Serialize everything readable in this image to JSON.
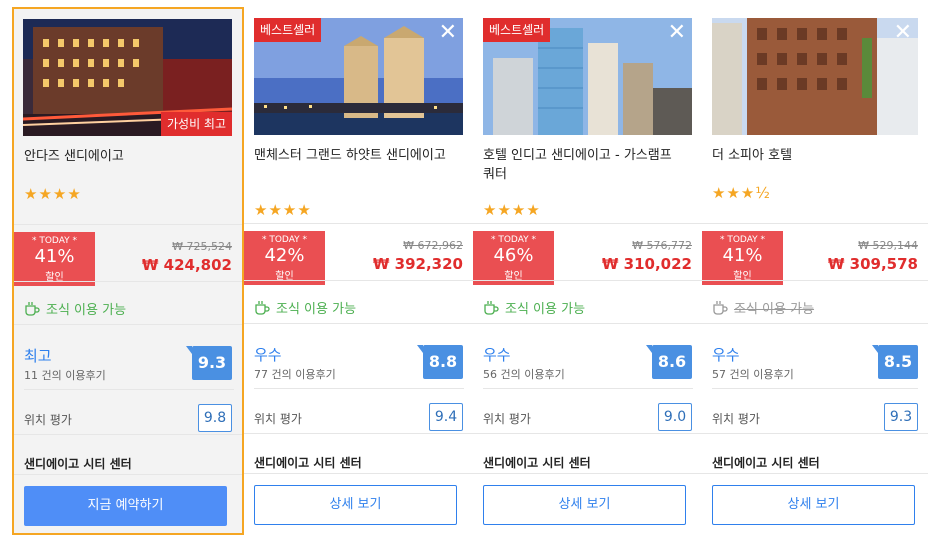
{
  "cards": [
    {
      "name": "안다즈 샌디에이고",
      "badge_bottom": "가성비 최고",
      "stars": "★★★★",
      "today_label": "* TODAY *",
      "discount": "41%",
      "discount_sub": "할인",
      "old_price": "₩ 725,524",
      "new_price": "₩ 424,802",
      "breakfast": "조식 이용 가능",
      "rating_word": "최고",
      "reviews": "11 건의 이용후기",
      "score": "9.3",
      "location_label": "위치 평가",
      "location_score": "9.8",
      "area": "샌디에이고 시티 센터",
      "button": "지금 예약하기"
    },
    {
      "name": "맨체스터 그랜드 하얏트 샌디에이고",
      "badge_top": "베스트셀러",
      "stars": "★★★★",
      "today_label": "* TODAY *",
      "discount": "42%",
      "discount_sub": "할인",
      "old_price": "₩ 672,962",
      "new_price": "₩ 392,320",
      "breakfast": "조식 이용 가능",
      "rating_word": "우수",
      "reviews": "77 건의 이용후기",
      "score": "8.8",
      "location_label": "위치 평가",
      "location_score": "9.4",
      "area": "샌디에이고 시티 센터",
      "button": "상세 보기"
    },
    {
      "name": "호텔 인디고 샌디에이고 - 가스램프 쿼터",
      "badge_top": "베스트셀러",
      "stars": "★★★★",
      "today_label": "* TODAY *",
      "discount": "46%",
      "discount_sub": "할인",
      "old_price": "₩ 576,772",
      "new_price": "₩ 310,022",
      "breakfast": "조식 이용 가능",
      "rating_word": "우수",
      "reviews": "56 건의 이용후기",
      "score": "8.6",
      "location_label": "위치 평가",
      "location_score": "9.0",
      "area": "샌디에이고 시티 센터",
      "button": "상세 보기"
    },
    {
      "name": "더 소피아 호텔",
      "stars": "★★★½",
      "today_label": "* TODAY *",
      "discount": "41%",
      "discount_sub": "할인",
      "old_price": "₩ 529,144",
      "new_price": "₩ 309,578",
      "breakfast": "조식 이용 가능",
      "rating_word": "우수",
      "reviews": "57 건의 이용후기",
      "score": "8.5",
      "location_label": "위치 평가",
      "location_score": "9.3",
      "area": "샌디에이고 시티 센터",
      "button": "상세 보기"
    }
  ],
  "icons": {
    "close": "close-icon",
    "breakfast": "coffee-cup-icon",
    "star": "star-icon"
  },
  "colors": {
    "accent": "#2f80ed",
    "discount": "#ea4f52",
    "selected_border": "#f5a623",
    "breakfast": "#4caf50"
  }
}
